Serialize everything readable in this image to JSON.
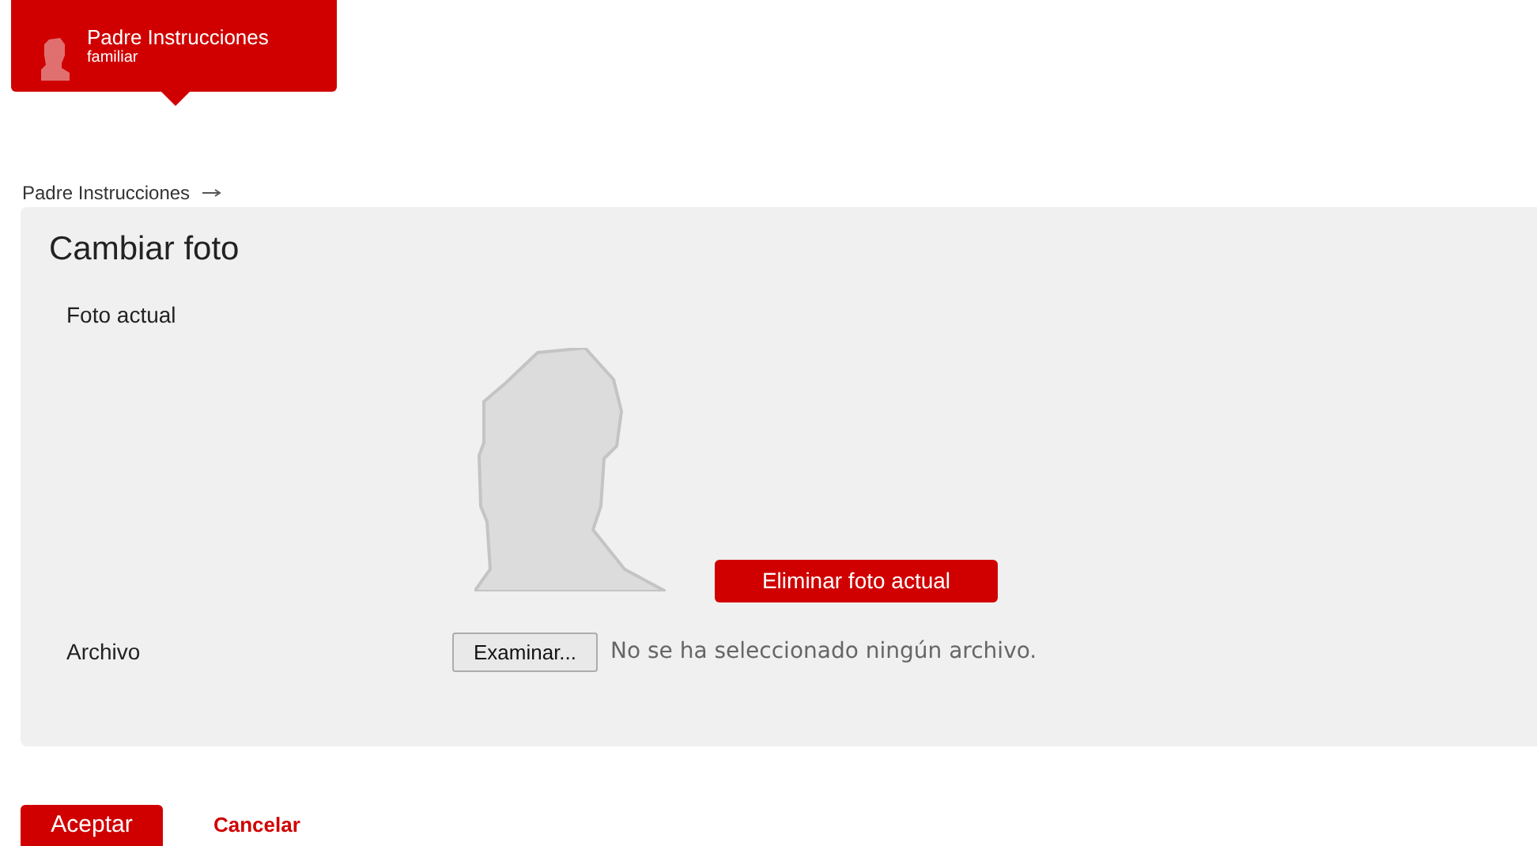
{
  "user_badge": {
    "name": "Padre Instrucciones",
    "role": "familiar"
  },
  "breadcrumb": {
    "items": [
      "Padre Instrucciones"
    ]
  },
  "panel": {
    "title": "Cambiar foto",
    "current_photo_label": "Foto actual",
    "delete_button": "Eliminar foto actual",
    "file_label": "Archivo",
    "browse_button": "Examinar...",
    "file_status": "No se ha seleccionado ningún archivo."
  },
  "actions": {
    "accept": "Aceptar",
    "cancel": "Cancelar"
  }
}
